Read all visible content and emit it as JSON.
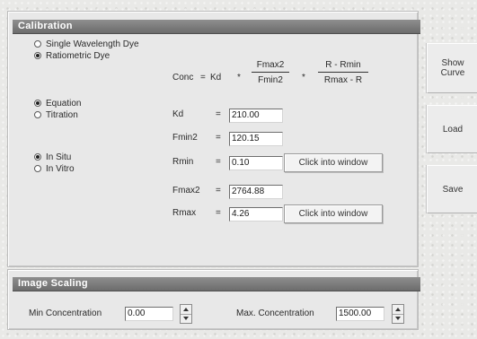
{
  "calibration": {
    "title": "Calibration",
    "dye_options": [
      {
        "label": "Single Wavelength Dye",
        "selected": false
      },
      {
        "label": "Ratiometric Dye",
        "selected": true
      }
    ],
    "method_options": [
      {
        "label": "Equation",
        "selected": true
      },
      {
        "label": "Titration",
        "selected": false
      }
    ],
    "location_options": [
      {
        "label": "In Situ",
        "selected": true
      },
      {
        "label": "In Vitro",
        "selected": false
      }
    ],
    "formula": {
      "lhs": "Conc",
      "eq": "=",
      "kd": "Kd",
      "times1": "*",
      "frac1_num": "Fmax2",
      "frac1_den": "Fmin2",
      "times2": "*",
      "frac2_num": "R - Rmin",
      "frac2_den": "Rmax - R"
    },
    "fields": [
      {
        "label": "Kd",
        "eq": "=",
        "value": "210.00"
      },
      {
        "label": "Fmin2",
        "eq": "=",
        "value": "120.15"
      },
      {
        "label": "Rmin",
        "eq": "=",
        "value": "0.10"
      },
      {
        "label": "Fmax2",
        "eq": "=",
        "value": "2764.88"
      },
      {
        "label": "Rmax",
        "eq": "=",
        "value": "4.26"
      }
    ],
    "rmin_button": "Click into window",
    "rmax_button": "Click into window"
  },
  "side_buttons": {
    "show_curve_line1": "Show",
    "show_curve_line2": "Curve",
    "load": "Load",
    "save": "Save"
  },
  "image_scaling": {
    "title": "Image Scaling",
    "min_label": "Min Concentration",
    "min_value": "0.00",
    "max_label": "Max. Concentration",
    "max_value": "1500.00"
  }
}
